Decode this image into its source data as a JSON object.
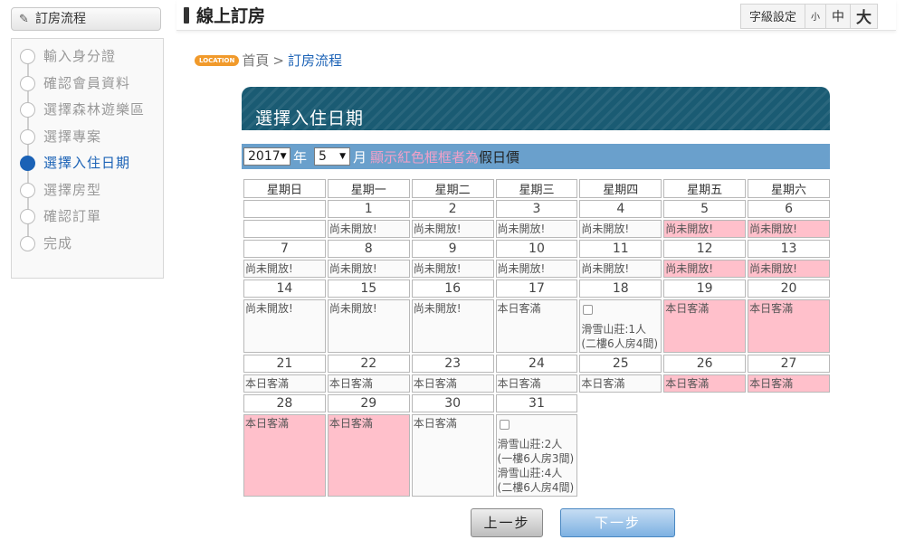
{
  "sidebar": {
    "header": "訂房流程",
    "steps": [
      {
        "label": "輸入身分證",
        "active": false
      },
      {
        "label": "確認會員資料",
        "active": false
      },
      {
        "label": "選擇森林遊樂區",
        "active": false
      },
      {
        "label": "選擇專案",
        "active": false
      },
      {
        "label": "選擇入住日期",
        "active": true
      },
      {
        "label": "選擇房型",
        "active": false
      },
      {
        "label": "確認訂單",
        "active": false
      },
      {
        "label": "完成",
        "active": false
      }
    ]
  },
  "header": {
    "title": "線上訂房",
    "font_size_label": "字級設定",
    "font_small": "小",
    "font_medium": "中",
    "font_large": "大"
  },
  "breadcrumb": {
    "badge": "LOCATION",
    "home": "首頁",
    "separator": ">",
    "current": "訂房流程"
  },
  "section": {
    "title": "選擇入住日期"
  },
  "month_bar": {
    "year_value": "2017",
    "year_suffix": "年",
    "month_value": "5",
    "month_suffix": "月",
    "hint_red": "顯示紅色框框者為",
    "hint_rest": "假日價"
  },
  "calendar": {
    "weekdays": [
      "星期日",
      "星期一",
      "星期二",
      "星期三",
      "星期四",
      "星期五",
      "星期六"
    ],
    "weeks": [
      [
        {
          "day": "",
          "text": [],
          "style": "blank"
        },
        {
          "day": "1",
          "text": [
            "尚未開放!"
          ],
          "style": "normal"
        },
        {
          "day": "2",
          "text": [
            "尚未開放!"
          ],
          "style": "normal"
        },
        {
          "day": "3",
          "text": [
            "尚未開放!"
          ],
          "style": "normal"
        },
        {
          "day": "4",
          "text": [
            "尚未開放!"
          ],
          "style": "normal"
        },
        {
          "day": "5",
          "text": [
            "尚未開放!"
          ],
          "style": "pink"
        },
        {
          "day": "6",
          "text": [
            "尚未開放!"
          ],
          "style": "pink"
        }
      ],
      [
        {
          "day": "7",
          "text": [
            "尚未開放!"
          ],
          "style": "normal"
        },
        {
          "day": "8",
          "text": [
            "尚未開放!"
          ],
          "style": "normal"
        },
        {
          "day": "9",
          "text": [
            "尚未開放!"
          ],
          "style": "normal"
        },
        {
          "day": "10",
          "text": [
            "尚未開放!"
          ],
          "style": "normal"
        },
        {
          "day": "11",
          "text": [
            "尚未開放!"
          ],
          "style": "normal"
        },
        {
          "day": "12",
          "text": [
            "尚未開放!"
          ],
          "style": "pink"
        },
        {
          "day": "13",
          "text": [
            "尚未開放!"
          ],
          "style": "pink"
        }
      ],
      [
        {
          "day": "14",
          "text": [
            "尚未開放!"
          ],
          "style": "normal"
        },
        {
          "day": "15",
          "text": [
            "尚未開放!"
          ],
          "style": "normal"
        },
        {
          "day": "16",
          "text": [
            "尚未開放!"
          ],
          "style": "normal"
        },
        {
          "day": "17",
          "text": [
            "本日客滿"
          ],
          "style": "normal"
        },
        {
          "day": "18",
          "checkbox": true,
          "text": [
            "滑雪山莊:1人",
            "(二樓6人房4間)"
          ],
          "style": "normal"
        },
        {
          "day": "19",
          "text": [
            "本日客滿"
          ],
          "style": "pink"
        },
        {
          "day": "20",
          "text": [
            "本日客滿"
          ],
          "style": "pink"
        }
      ],
      [
        {
          "day": "21",
          "text": [
            "本日客滿"
          ],
          "style": "normal"
        },
        {
          "day": "22",
          "text": [
            "本日客滿"
          ],
          "style": "normal"
        },
        {
          "day": "23",
          "text": [
            "本日客滿"
          ],
          "style": "normal"
        },
        {
          "day": "24",
          "text": [
            "本日客滿"
          ],
          "style": "normal"
        },
        {
          "day": "25",
          "text": [
            "本日客滿"
          ],
          "style": "normal"
        },
        {
          "day": "26",
          "text": [
            "本日客滿"
          ],
          "style": "pink"
        },
        {
          "day": "27",
          "text": [
            "本日客滿"
          ],
          "style": "pink"
        }
      ],
      [
        {
          "day": "28",
          "text": [
            "本日客滿"
          ],
          "style": "pink"
        },
        {
          "day": "29",
          "text": [
            "本日客滿"
          ],
          "style": "pink"
        },
        {
          "day": "30",
          "text": [
            "本日客滿"
          ],
          "style": "normal"
        },
        {
          "day": "31",
          "checkbox": true,
          "text": [
            "滑雪山莊:2人",
            "(一樓6人房3間)",
            "滑雪山莊:4人",
            "(二樓6人房4間)"
          ],
          "style": "normal"
        }
      ]
    ]
  },
  "buttons": {
    "prev": "上一步",
    "next": "下一步"
  },
  "colors": {
    "active_blue": "#1b62b6",
    "header_teal": "#1a5b73",
    "month_bar": "#6aa0cc",
    "holiday_pink": "#ffc0cb",
    "location_orange": "#f19a2b"
  }
}
